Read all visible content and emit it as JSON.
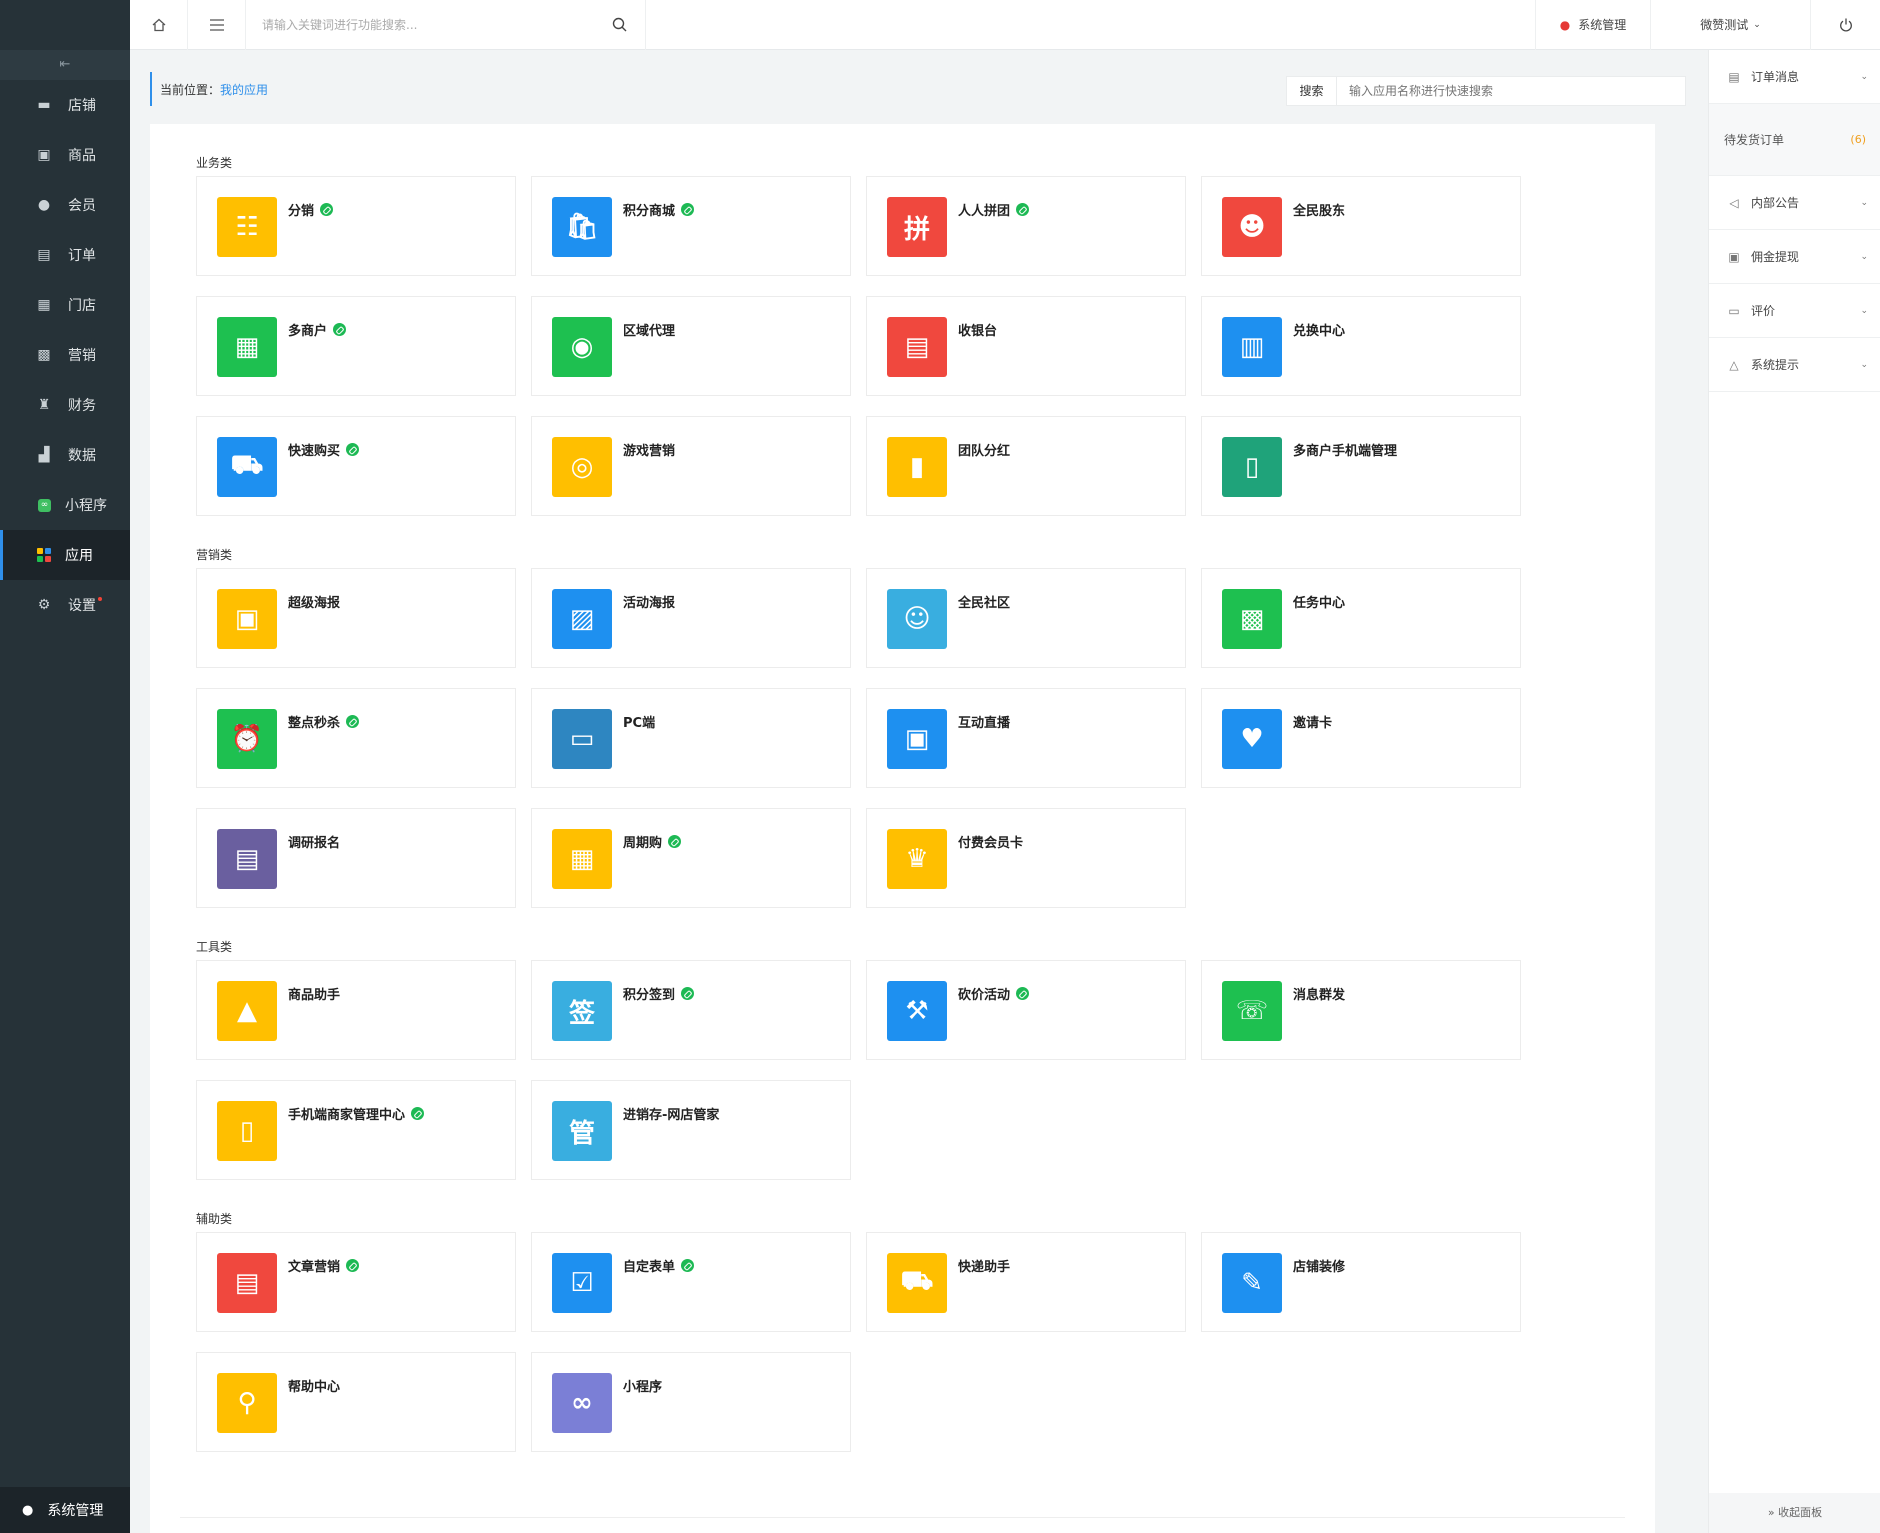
{
  "sidebar": {
    "collapse_label": "⇤",
    "items": [
      {
        "label": "店铺",
        "icon": "store-icon",
        "glyph": "▬"
      },
      {
        "label": "商品",
        "icon": "goods-icon",
        "glyph": "▣"
      },
      {
        "label": "会员",
        "icon": "member-icon",
        "glyph": "●"
      },
      {
        "label": "订单",
        "icon": "order-icon",
        "glyph": "▤"
      },
      {
        "label": "门店",
        "icon": "shop-icon",
        "glyph": "▦"
      },
      {
        "label": "营销",
        "icon": "marketing-icon",
        "glyph": "▩"
      },
      {
        "label": "财务",
        "icon": "finance-icon",
        "glyph": "♜"
      },
      {
        "label": "数据",
        "icon": "data-icon",
        "glyph": "▟"
      }
    ],
    "miniapp_label": "小程序",
    "apps_label": "应用",
    "settings_label": "设置",
    "bottom_label": "系统管理"
  },
  "topbar": {
    "search_placeholder": "请输入关键词进行功能搜索...",
    "sys_label": "系统管理",
    "store_label": "微赞测试"
  },
  "breadcrumb": {
    "prefix": "当前位置：",
    "current": "我的应用"
  },
  "quick_search": {
    "button": "搜索",
    "placeholder": "输入应用名称进行快速搜索"
  },
  "sections": [
    {
      "title": "业务类",
      "apps": [
        {
          "name": "分销",
          "badge": true,
          "color": "#ffbf00",
          "glyph": "☷"
        },
        {
          "name": "积分商城",
          "badge": true,
          "color": "#1e90f0",
          "glyph": "🛍"
        },
        {
          "name": "人人拼团",
          "badge": true,
          "color": "#f0483e",
          "glyph": "拼"
        },
        {
          "name": "全民股东",
          "badge": false,
          "color": "#f0483e",
          "glyph": "☻"
        },
        {
          "name": "多商户",
          "badge": true,
          "color": "#1ec050",
          "glyph": "▦"
        },
        {
          "name": "区域代理",
          "badge": false,
          "color": "#1ec050",
          "glyph": "◉"
        },
        {
          "name": "收银台",
          "badge": false,
          "color": "#f0483e",
          "glyph": "▤"
        },
        {
          "name": "兑换中心",
          "badge": false,
          "color": "#1e90f0",
          "glyph": "▥"
        },
        {
          "name": "快速购买",
          "badge": true,
          "color": "#1e90f0",
          "glyph": "⛟"
        },
        {
          "name": "游戏营销",
          "badge": false,
          "color": "#ffbf00",
          "glyph": "◎"
        },
        {
          "name": "团队分红",
          "badge": false,
          "color": "#ffbf00",
          "glyph": "▮"
        },
        {
          "name": "多商户手机端管理",
          "badge": false,
          "color": "#1fa37a",
          "glyph": "▯"
        }
      ]
    },
    {
      "title": "营销类",
      "apps": [
        {
          "name": "超级海报",
          "badge": false,
          "color": "#ffbf00",
          "glyph": "▣"
        },
        {
          "name": "活动海报",
          "badge": false,
          "color": "#1e90f0",
          "glyph": "▨"
        },
        {
          "name": "全民社区",
          "badge": false,
          "color": "#39aee0",
          "glyph": "☺"
        },
        {
          "name": "任务中心",
          "badge": false,
          "color": "#1ec050",
          "glyph": "▩"
        },
        {
          "name": "整点秒杀",
          "badge": true,
          "color": "#1ec050",
          "glyph": "⏰"
        },
        {
          "name": "PC端",
          "badge": false,
          "color": "#2e86c1",
          "glyph": "▭"
        },
        {
          "name": "互动直播",
          "badge": false,
          "color": "#1e90f0",
          "glyph": "▣"
        },
        {
          "name": "邀请卡",
          "badge": false,
          "color": "#1e90f0",
          "glyph": "♥"
        },
        {
          "name": "调研报名",
          "badge": false,
          "color": "#6a5f9f",
          "glyph": "▤"
        },
        {
          "name": "周期购",
          "badge": true,
          "color": "#ffbf00",
          "glyph": "▦"
        },
        {
          "name": "付费会员卡",
          "badge": false,
          "color": "#ffbf00",
          "glyph": "♛"
        }
      ]
    },
    {
      "title": "工具类",
      "apps": [
        {
          "name": "商品助手",
          "badge": false,
          "color": "#ffbf00",
          "glyph": "▲"
        },
        {
          "name": "积分签到",
          "badge": true,
          "color": "#39aee0",
          "glyph": "签"
        },
        {
          "name": "砍价活动",
          "badge": true,
          "color": "#1e90f0",
          "glyph": "⚒"
        },
        {
          "name": "消息群发",
          "badge": false,
          "color": "#1ec050",
          "glyph": "☏"
        },
        {
          "name": "手机端商家管理中心",
          "badge": true,
          "color": "#ffbf00",
          "glyph": "▯"
        },
        {
          "name": "进销存-网店管家",
          "badge": false,
          "color": "#39aee0",
          "glyph": "管"
        }
      ]
    },
    {
      "title": "辅助类",
      "apps": [
        {
          "name": "文章营销",
          "badge": true,
          "color": "#f0483e",
          "glyph": "▤"
        },
        {
          "name": "自定表单",
          "badge": true,
          "color": "#1e90f0",
          "glyph": "☑"
        },
        {
          "name": "快递助手",
          "badge": false,
          "color": "#ffbf00",
          "glyph": "⛟"
        },
        {
          "name": "店铺装修",
          "badge": false,
          "color": "#1e90f0",
          "glyph": "✎"
        },
        {
          "name": "帮助中心",
          "badge": false,
          "color": "#ffbf00",
          "glyph": "⚲"
        },
        {
          "name": "小程序",
          "badge": false,
          "color": "#7b7fd6",
          "glyph": "∞"
        }
      ]
    }
  ],
  "right_panel": {
    "order_msg": "订单消息",
    "pending_orders": "待发货订单",
    "pending_count": "(6)",
    "notice": "内部公告",
    "commission": "佣金提现",
    "review": "评价",
    "system_tip": "系统提示",
    "collapse": "» 收起面板"
  }
}
